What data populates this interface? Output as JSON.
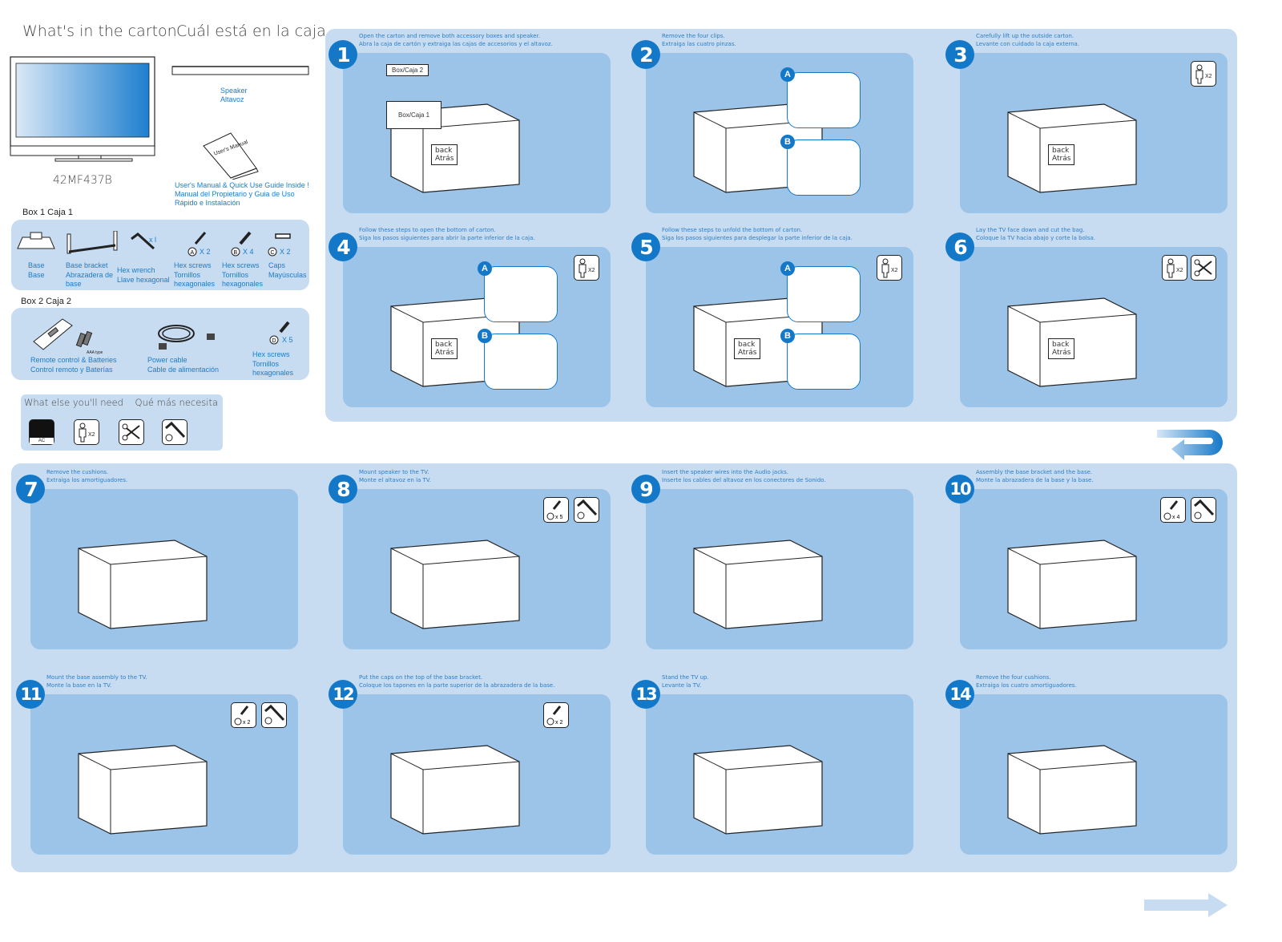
{
  "header": {
    "title_en": "What's in the carton",
    "title_es": "Cuál está en la caja"
  },
  "contents": {
    "tv_model": "42MF437B",
    "speaker": [
      "Speaker",
      "Altavoz"
    ],
    "manual_cover": "User's Manual",
    "manual": [
      "User's Manual & Quick Use Guide Inside !",
      "Manual del Propietario y Guia de Uso",
      "Rápido e Instalación"
    ],
    "box1": {
      "title": "Box 1   Caja  1",
      "items": [
        {
          "name": "Base",
          "lines": [
            "Base",
            "Base"
          ],
          "qty": ""
        },
        {
          "name": "Base bracket",
          "lines": [
            "Base bracket",
            "Abrazadera de",
            "base"
          ],
          "qty": ""
        },
        {
          "name": "Hex wrench",
          "lines": [
            "Hex wrench",
            "Llave hexagonal"
          ],
          "qty": "x l"
        },
        {
          "name": "Hex screws A",
          "lines": [
            "Hex screws",
            "Tornillos",
            "hexagonales"
          ],
          "letter": "A",
          "qty": "X 2"
        },
        {
          "name": "Hex screws B",
          "lines": [
            "Hex screws",
            "Tornillos",
            "hexagonales"
          ],
          "letter": "B",
          "qty": "X 4"
        },
        {
          "name": "Caps",
          "lines": [
            "Caps",
            "Mayúsculas"
          ],
          "letter": "C",
          "qty": "X 2"
        }
      ]
    },
    "box2": {
      "title": "Box 2   Caja  2",
      "items": [
        {
          "name": "Remote control",
          "lines": [
            "Remote control & Batteries",
            "Control remoto y Baterías"
          ],
          "note": "AAA type x2"
        },
        {
          "name": "Power cable",
          "lines": [
            "Power cable",
            "Cable de alimentación"
          ]
        },
        {
          "name": "Hex screws D",
          "lines": [
            "Hex screws",
            "Tornillos",
            "hexagonales"
          ],
          "letter": "D",
          "qty": "X 5"
        }
      ]
    },
    "need": {
      "title": "What else you'll need    Qué más necesita",
      "ac_label": "AC",
      "persons": "X2"
    }
  },
  "steps": [
    {
      "num": "1",
      "en": "Open the carton and remove both accessory boxes and speaker.",
      "es": "Abra la caja de cartón y extraiga las cajas de accesorios y el altavoz.",
      "box2": "Box/Caja  2",
      "box1": "Box/Caja  1",
      "back": [
        "back",
        "Atrás"
      ]
    },
    {
      "num": "2",
      "en": "Remove the four clips.",
      "es": "Extraiga las cuatro pinzas.",
      "subs": [
        "A",
        "B"
      ]
    },
    {
      "num": "3",
      "en": "Carefully lift up the outside carton.",
      "es": "Levante con cuidado la caja externa.",
      "persons": "X2",
      "back": [
        "back",
        "Atrás"
      ]
    },
    {
      "num": "4",
      "en": "Follow these steps to open the bottom of carton.",
      "es": "Siga los pasos siguientes para abrir la parte inferior de la caja.",
      "persons": "X2",
      "subs": [
        "A",
        "B"
      ],
      "back": [
        "back",
        "Atrás"
      ]
    },
    {
      "num": "5",
      "en": "Follow these steps to unfold the bottom of carton.",
      "es": "Siga los pasos siguientes para desplegar la parte inferior de la caja.",
      "persons": "X2",
      "subs": [
        "A",
        "B"
      ],
      "back": [
        "back",
        "Atrás"
      ]
    },
    {
      "num": "6",
      "en": "Lay the TV face down and cut the bag.",
      "es": "Coloque la TV hacia abajo y corte la bolsa.",
      "persons": "X2",
      "back": [
        "back",
        "Atrás"
      ]
    },
    {
      "num": "7",
      "en": "Remove the cushions.",
      "es": "Extraiga los amortiguadores."
    },
    {
      "num": "8",
      "en": "Mount speaker to the TV.",
      "es": "Monte el altavoz en la TV.",
      "screw": "D",
      "qty": "x 5"
    },
    {
      "num": "9",
      "en": "Insert the speaker wires into the Audio jacks.",
      "es": "Inserte los cables del altavoz en los conectores de Sonido."
    },
    {
      "num": "10",
      "en": "Assembly the base bracket and the base.",
      "es": "Monte la abrazadera de la base y la base.",
      "screw": "B",
      "qty": "x 4"
    },
    {
      "num": "11",
      "en": "Mount the base assembly to the TV.",
      "es": "Monte la base en la TV.",
      "screw": "A",
      "qty": "x 2"
    },
    {
      "num": "12",
      "en": "Put the caps on the top of the base bracket.",
      "es": "Coloque los tapones en la parte superior de la abrazadera de la base.",
      "screw": "C",
      "qty": "x 2"
    },
    {
      "num": "13",
      "en": "Stand the TV up.",
      "es": "Levante la TV."
    },
    {
      "num": "14",
      "en": "Remove the four cushions.",
      "es": "Extraiga los cuatro amortiguadores."
    }
  ],
  "colors": {
    "accent": "#1478c8",
    "panel_light": "#c8dcf1",
    "panel_medium": "#9cc4e8",
    "text_blue": "#1a7ccc"
  }
}
